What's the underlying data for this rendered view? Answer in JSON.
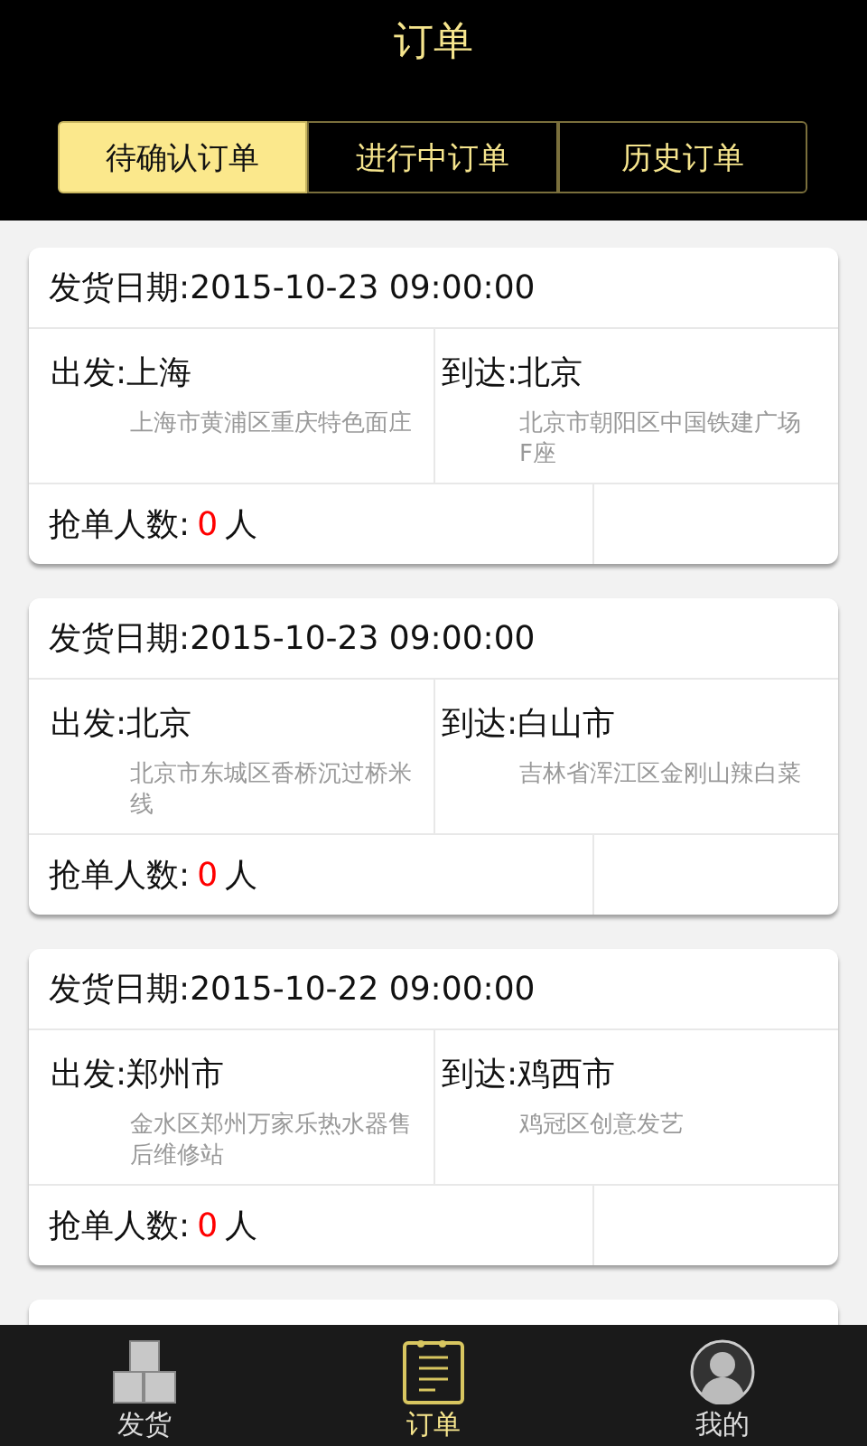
{
  "header": {
    "title": "订单"
  },
  "tabs": [
    {
      "label": "待确认订单",
      "selected": true
    },
    {
      "label": "进行中订单",
      "selected": false
    },
    {
      "label": "历史订单",
      "selected": false
    }
  ],
  "orders": [
    {
      "kind": "full",
      "date": "发货日期:2015-10-23 09:00:00",
      "from": "出发:上海",
      "from_address": "上海市黄浦区重庆特色面庄",
      "to": "到达:北京",
      "to_address": "北京市朝阳区中国铁建广场F座",
      "count_label": "抢单人数:",
      "count": "0",
      "count_unit": "人"
    },
    {
      "kind": "full",
      "date": "发货日期:2015-10-23 09:00:00",
      "from": "出发:北京",
      "from_address": "北京市东城区香桥沉过桥米线",
      "to": "到达:白山市",
      "to_address": "吉林省浑江区金刚山辣白菜",
      "count_label": "抢单人数:",
      "count": "0",
      "count_unit": "人"
    },
    {
      "kind": "full",
      "date": "发货日期:2015-10-22 09:00:00",
      "from": "出发:郑州市",
      "from_address": "金水区郑州万家乐热水器售后维修站",
      "to": "到达:鸡西市",
      "to_address": "鸡冠区创意发艺",
      "count_label": "抢单人数:",
      "count": "0",
      "count_unit": "人"
    },
    {
      "kind": "partial"
    }
  ],
  "nav": [
    {
      "label": "发货",
      "kind": "boxes",
      "selected": false
    },
    {
      "label": "订单",
      "kind": "notepad",
      "selected": true
    },
    {
      "label": "我的",
      "kind": "person",
      "selected": false
    }
  ]
}
